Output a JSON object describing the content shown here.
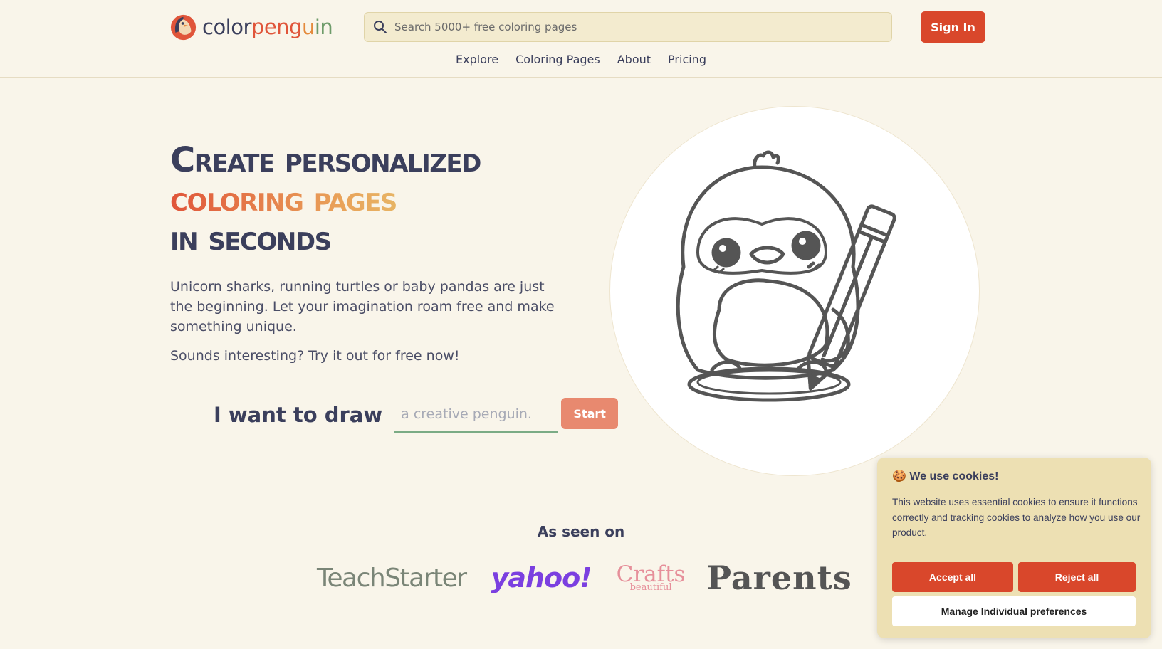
{
  "header": {
    "logo": {
      "part1": "color",
      "part2": "peng",
      "part3": "u",
      "part4": "in"
    },
    "search_placeholder": "Search 5000+ free coloring pages",
    "signin_label": "Sign In",
    "nav": [
      "Explore",
      "Coloring Pages",
      "About",
      "Pricing"
    ]
  },
  "hero": {
    "headline_line1": "Create personalized",
    "headline_line2": "coloring pages",
    "headline_line3": "in seconds",
    "intro": "Unicorn sharks, running turtles or baby pandas are just the beginning. Let your imagination roam free and make something unique.",
    "tryit": "Sounds interesting? Try it out for free now!",
    "draw_label": "I want to draw",
    "draw_placeholder": "a creative penguin.",
    "start_label": "Start"
  },
  "seen_on": {
    "title": "As seen on",
    "brands": [
      "TeachStarter",
      "yahoo!",
      "Crafts",
      "beautiful",
      "Parents"
    ]
  },
  "cookie": {
    "title": "🍪 We use cookies!",
    "text": "This website uses essential cookies to ensure it functions correctly and tracking cookies to analyze how you use our product.",
    "accept_label": "Accept all",
    "reject_label": "Reject all",
    "manage_label": "Manage Individual preferences"
  },
  "colors": {
    "accent": "#d9472b",
    "background": "#f9f5ea",
    "text": "#3b3f5c",
    "green": "#7bab85",
    "cookie_bg": "#ede0b3"
  }
}
